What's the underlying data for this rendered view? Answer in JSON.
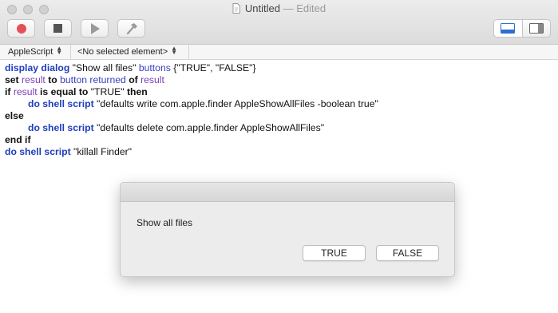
{
  "window": {
    "title": "Untitled",
    "title_suffix": "— Edited"
  },
  "toolbar": {
    "record_icon": "record-icon",
    "stop_icon": "stop-icon",
    "run_icon": "play-icon",
    "compile_icon": "hammer-icon",
    "view_toggle": [
      "bottom-pane-icon",
      "side-pane-icon"
    ],
    "record_color": "#e4505a"
  },
  "navbar": {
    "language": "AppleScript",
    "element": "<No selected element>"
  },
  "script": {
    "lines": [
      [
        {
          "t": "display dialog",
          "c": "kw"
        },
        {
          "t": " \"Show all files\" ",
          "c": "str"
        },
        {
          "t": "buttons",
          "c": "cmd"
        },
        {
          "t": " {\"TRUE\", \"FALSE\"}",
          "c": "str"
        }
      ],
      [
        {
          "t": "set",
          "c": "bk"
        },
        {
          "t": " ",
          "c": "str"
        },
        {
          "t": "result",
          "c": "var"
        },
        {
          "t": " ",
          "c": "str"
        },
        {
          "t": "to",
          "c": "bk"
        },
        {
          "t": " ",
          "c": "str"
        },
        {
          "t": "button returned",
          "c": "cmd"
        },
        {
          "t": " ",
          "c": "str"
        },
        {
          "t": "of",
          "c": "bk"
        },
        {
          "t": " ",
          "c": "str"
        },
        {
          "t": "result",
          "c": "var"
        }
      ],
      [
        {
          "t": "if",
          "c": "bk"
        },
        {
          "t": " ",
          "c": "str"
        },
        {
          "t": "result",
          "c": "var"
        },
        {
          "t": " ",
          "c": "str"
        },
        {
          "t": "is equal to",
          "c": "bk"
        },
        {
          "t": " \"TRUE\" ",
          "c": "str"
        },
        {
          "t": "then",
          "c": "bk"
        }
      ],
      [
        {
          "t": "INDENT",
          "c": "indent"
        },
        {
          "t": "do shell script",
          "c": "kw"
        },
        {
          "t": " \"defaults write com.apple.finder AppleShowAllFiles -boolean true\"",
          "c": "str"
        }
      ],
      [
        {
          "t": "else",
          "c": "bk"
        }
      ],
      [
        {
          "t": "INDENT",
          "c": "indent"
        },
        {
          "t": "do shell script",
          "c": "kw"
        },
        {
          "t": " \"defaults delete com.apple.finder AppleShowAllFiles\"",
          "c": "str"
        }
      ],
      [
        {
          "t": "end if",
          "c": "bk"
        }
      ],
      [
        {
          "t": "do shell script",
          "c": "kw"
        },
        {
          "t": " \"killall Finder\"",
          "c": "str"
        }
      ]
    ]
  },
  "dialog": {
    "message": "Show all files",
    "buttons": [
      "TRUE",
      "FALSE"
    ]
  }
}
